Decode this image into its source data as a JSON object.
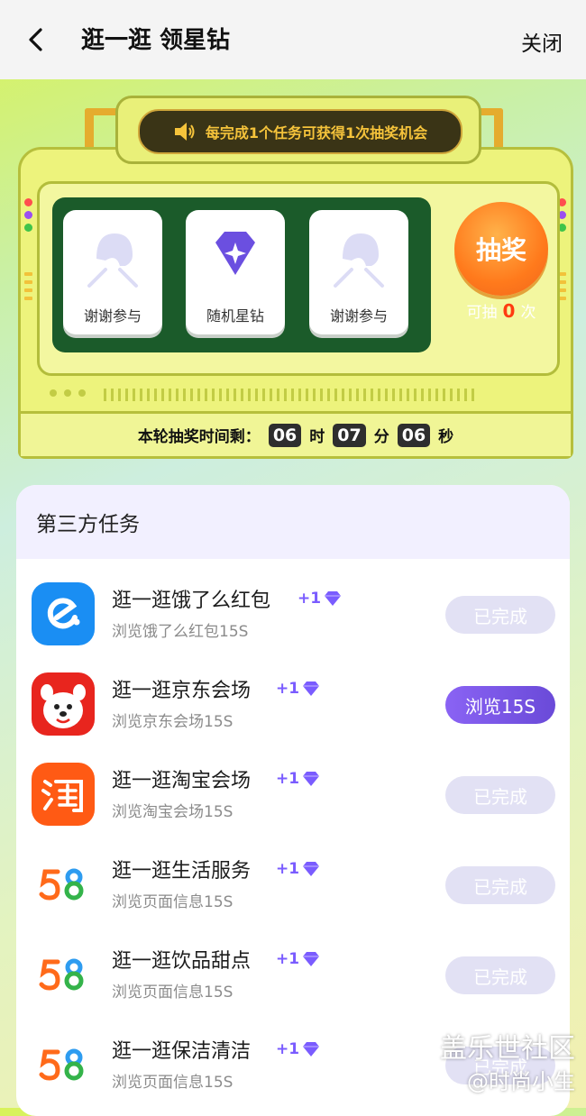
{
  "header": {
    "back_icon": "chevron-left-icon",
    "title": "逛一逛 领星钻",
    "close_label": "关闭"
  },
  "machine": {
    "sign_text": "每完成1个任务可获得1次抽奖机会",
    "slots": [
      {
        "label": "谢谢参与",
        "icon": "thanks-icon"
      },
      {
        "label": "随机星钻",
        "icon": "diamond-icon"
      },
      {
        "label": "谢谢参与",
        "icon": "thanks-icon"
      }
    ],
    "draw_label": "抽奖",
    "draw_count_prefix": "可抽",
    "draw_count": "0",
    "draw_count_suffix": "次",
    "timer_label": "本轮抽奖时间剩：",
    "hours": "06",
    "hours_unit": "时",
    "minutes": "07",
    "minutes_unit": "分",
    "seconds": "06",
    "seconds_unit": "秒"
  },
  "tasks": {
    "section_title": "第三方任务",
    "items": [
      {
        "title": "逛一逛饿了么红包",
        "reward": "+1",
        "desc": "浏览饿了么红包15S",
        "button": "已完成",
        "state": "done",
        "app": "eleme"
      },
      {
        "title": "逛一逛京东会场",
        "reward": "+1",
        "desc": "浏览京东会场15S",
        "button": "浏览15S",
        "state": "active",
        "app": "jd"
      },
      {
        "title": "逛一逛淘宝会场",
        "reward": "+1",
        "desc": "浏览淘宝会场15S",
        "button": "已完成",
        "state": "done",
        "app": "taobao"
      },
      {
        "title": "逛一逛生活服务",
        "reward": "+1",
        "desc": "浏览页面信息15S",
        "button": "已完成",
        "state": "done",
        "app": "58"
      },
      {
        "title": "逛一逛饮品甜点",
        "reward": "+1",
        "desc": "浏览页面信息15S",
        "button": "已完成",
        "state": "done",
        "app": "58"
      },
      {
        "title": "逛一逛保洁清洁",
        "reward": "+1",
        "desc": "浏览页面信息15S",
        "button": "已完成",
        "state": "done",
        "app": "58"
      }
    ]
  },
  "watermark": {
    "line1": "盖乐世社区",
    "line2": "@时尚小生"
  },
  "colors": {
    "accent": "#7a5cff",
    "draw_button": "#ff7a1c",
    "screen": "#1b5b2a"
  }
}
